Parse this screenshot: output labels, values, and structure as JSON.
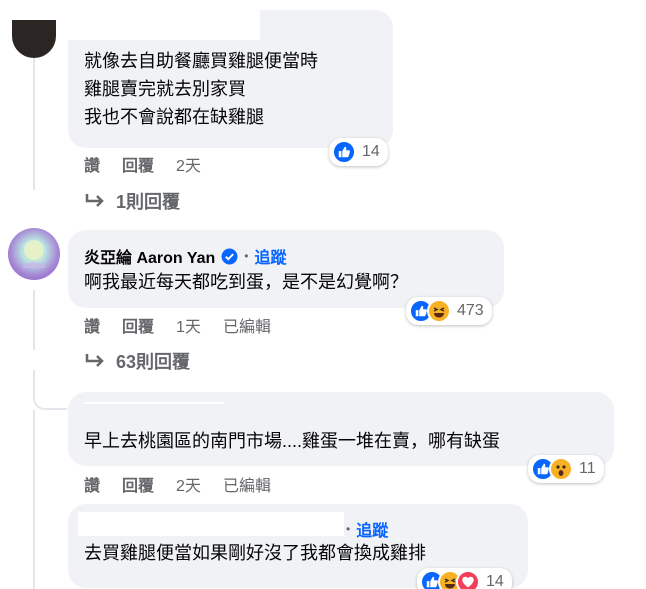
{
  "comments": [
    {
      "lines": [
        "就像去自助餐廳買雞腿便當時",
        "雞腿賣完就去別家買",
        "我也不會說都在缺雞腿"
      ],
      "actions": {
        "like": "讚",
        "reply": "回覆",
        "time": "2天"
      },
      "reactions": {
        "icons": [
          "like-icon"
        ],
        "count": "14"
      },
      "replies_link": "1則回覆"
    },
    {
      "author": "炎亞綸 Aaron Yan",
      "verified_icon": "verified-badge-icon",
      "follow": "追蹤",
      "lines": [
        "啊我最近每天都吃到蛋，是不是幻覺啊？"
      ],
      "actions": {
        "like": "讚",
        "reply": "回覆",
        "time": "1天",
        "edited": "已編輯"
      },
      "reactions": {
        "icons": [
          "like-icon",
          "haha-icon"
        ],
        "count": "473"
      },
      "replies_link": "63則回覆"
    },
    {
      "lines": [
        "早上去桃園區的南門市場....雞蛋一堆在賣，哪有缺蛋"
      ],
      "actions": {
        "like": "讚",
        "reply": "回覆",
        "time": "2天",
        "edited": "已編輯"
      },
      "reactions": {
        "icons": [
          "like-icon",
          "wow-icon"
        ],
        "count": "11"
      }
    },
    {
      "follow": "追蹤",
      "lines": [
        "去買雞腿便當如果剛好沒了我都會換成雞排"
      ],
      "reactions": {
        "icons": [
          "like-icon",
          "haha-icon",
          "love-icon"
        ],
        "count": "14"
      }
    }
  ],
  "colors": {
    "bubble": "#f0f2f5",
    "link": "#0866ff",
    "meta": "#65676b",
    "like": "#0866ff",
    "haha": "#f7b125",
    "love": "#f33e58"
  }
}
